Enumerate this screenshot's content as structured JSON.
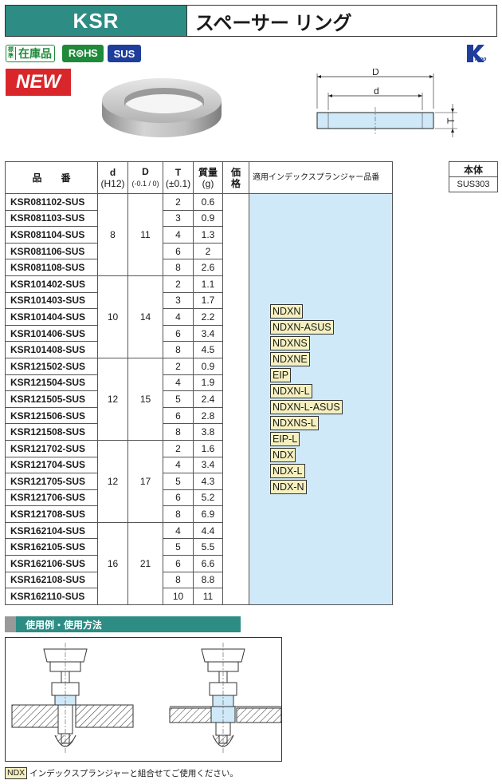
{
  "header": {
    "code": "KSR",
    "name": "スペーサー リング"
  },
  "badges": {
    "stock_small": "標準",
    "stock": "在庫品",
    "rohs": "R⊛HS",
    "sus": "SUS",
    "new": "NEW"
  },
  "drawing": {
    "outer_label": "D",
    "inner_label": "d",
    "thickness_label": "T"
  },
  "table": {
    "headers": {
      "part": "品　　番",
      "d": "d",
      "d_sub": "(H12)",
      "D": "D",
      "D_sub": "(-0.1 / 0)",
      "T": "T",
      "T_sub": "(±0.1)",
      "w": "質量",
      "w_sub": "(g)",
      "price": "価　格",
      "applic": "適用インデックスプランジャー品番"
    },
    "rows": [
      {
        "pn": "KSR081102-SUS",
        "t": "2",
        "w": "0.6"
      },
      {
        "pn": "KSR081103-SUS",
        "t": "3",
        "w": "0.9"
      },
      {
        "pn": "KSR081104-SUS",
        "t": "4",
        "w": "1.3"
      },
      {
        "pn": "KSR081106-SUS",
        "t": "6",
        "w": "2"
      },
      {
        "pn": "KSR081108-SUS",
        "t": "8",
        "w": "2.6"
      },
      {
        "pn": "KSR101402-SUS",
        "t": "2",
        "w": "1.1"
      },
      {
        "pn": "KSR101403-SUS",
        "t": "3",
        "w": "1.7"
      },
      {
        "pn": "KSR101404-SUS",
        "t": "4",
        "w": "2.2"
      },
      {
        "pn": "KSR101406-SUS",
        "t": "6",
        "w": "3.4"
      },
      {
        "pn": "KSR101408-SUS",
        "t": "8",
        "w": "4.5"
      },
      {
        "pn": "KSR121502-SUS",
        "t": "2",
        "w": "0.9"
      },
      {
        "pn": "KSR121504-SUS",
        "t": "4",
        "w": "1.9"
      },
      {
        "pn": "KSR121505-SUS",
        "t": "5",
        "w": "2.4"
      },
      {
        "pn": "KSR121506-SUS",
        "t": "6",
        "w": "2.8"
      },
      {
        "pn": "KSR121508-SUS",
        "t": "8",
        "w": "3.8"
      },
      {
        "pn": "KSR121702-SUS",
        "t": "2",
        "w": "1.6"
      },
      {
        "pn": "KSR121704-SUS",
        "t": "4",
        "w": "3.4"
      },
      {
        "pn": "KSR121705-SUS",
        "t": "5",
        "w": "4.3"
      },
      {
        "pn": "KSR121706-SUS",
        "t": "6",
        "w": "5.2"
      },
      {
        "pn": "KSR121708-SUS",
        "t": "8",
        "w": "6.9"
      },
      {
        "pn": "KSR162104-SUS",
        "t": "4",
        "w": "4.4"
      },
      {
        "pn": "KSR162105-SUS",
        "t": "5",
        "w": "5.5"
      },
      {
        "pn": "KSR162106-SUS",
        "t": "6",
        "w": "6.6"
      },
      {
        "pn": "KSR162108-SUS",
        "t": "8",
        "w": "8.8"
      },
      {
        "pn": "KSR162110-SUS",
        "t": "10",
        "w": "11"
      }
    ],
    "groups": [
      {
        "d": "8",
        "D": "11"
      },
      {
        "d": "10",
        "D": "14"
      },
      {
        "d": "12",
        "D": "15"
      },
      {
        "d": "12",
        "D": "17"
      },
      {
        "d": "16",
        "D": "21"
      }
    ],
    "plungers": [
      "NDXN",
      "NDXN-ASUS",
      "NDXNS",
      "NDXNE",
      "EIP",
      "NDXN-L",
      "NDXN-L-ASUS",
      "NDXNS-L",
      "EIP-L",
      "NDX",
      "NDX-L",
      "NDX-N"
    ]
  },
  "material": {
    "header": "本体",
    "value": "SUS303"
  },
  "usage": {
    "title": "使用例・使用方法"
  },
  "note": {
    "tag": "NDX",
    "text": "インデックスプランジャーと組合せてご使用ください。"
  },
  "colors": {
    "teal": "#2d8c84",
    "light_blue": "#cfe9f8",
    "tag_yellow": "#f5f0bf",
    "new_red": "#d9262b",
    "green": "#1e8a3a",
    "sus_blue": "#1f3e9c"
  }
}
